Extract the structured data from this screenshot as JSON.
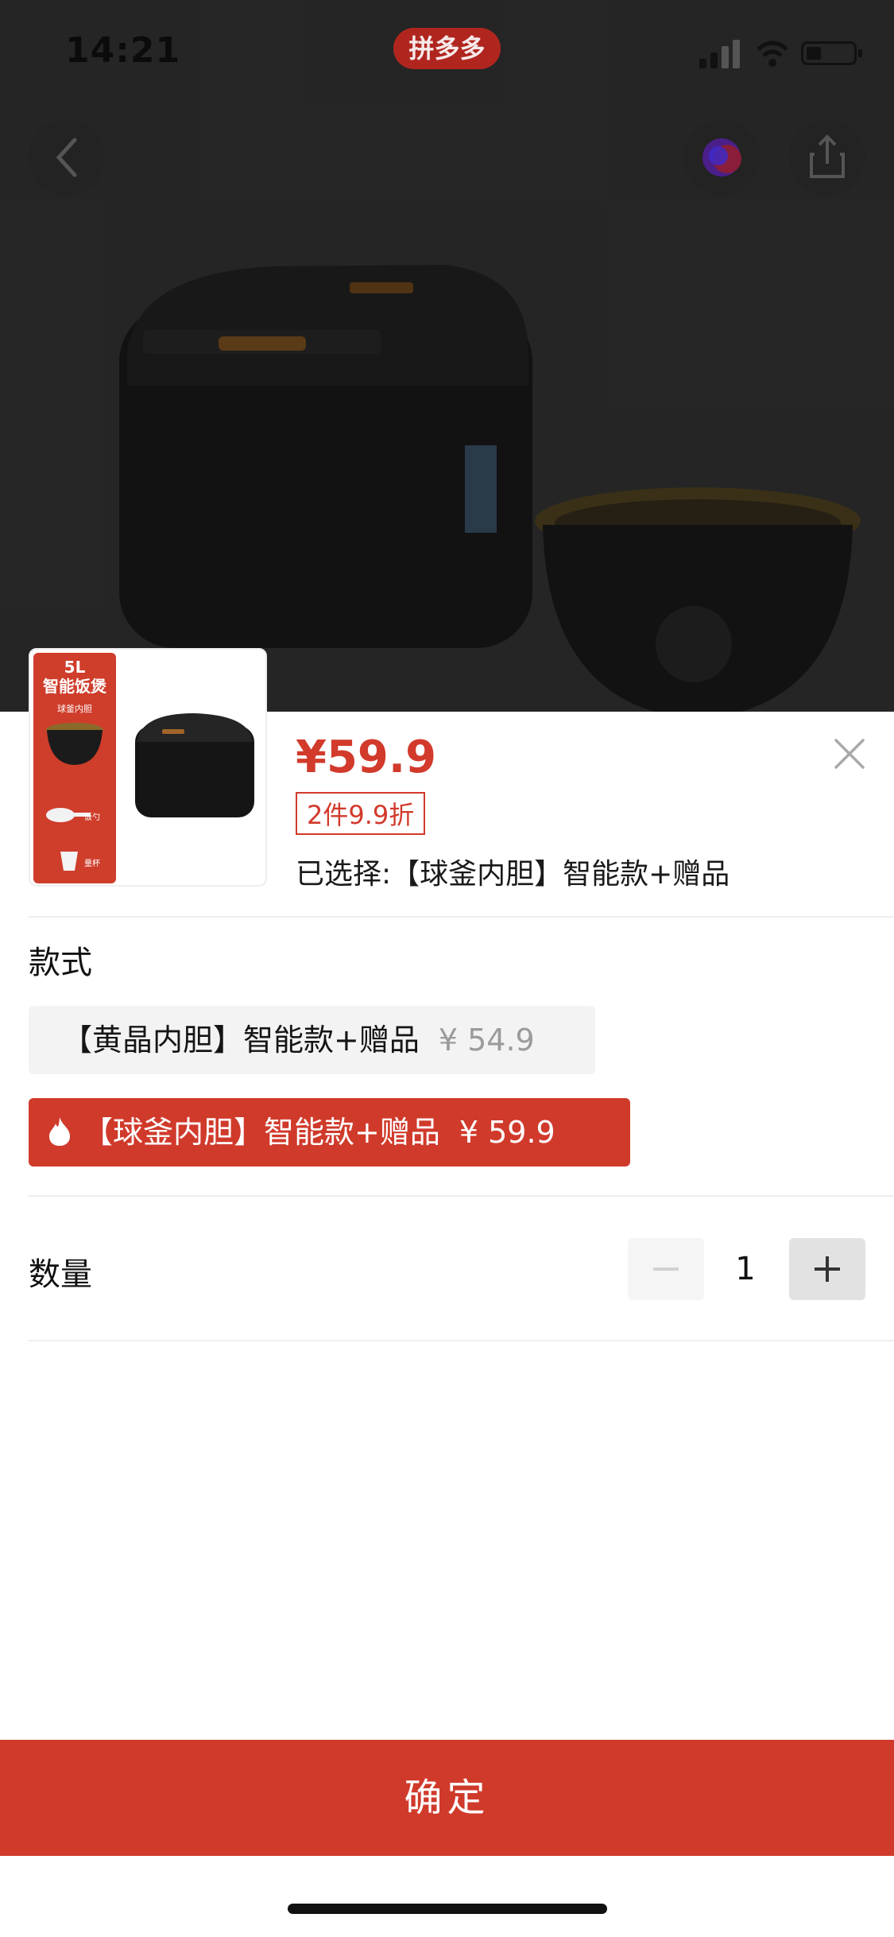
{
  "status_bar": {
    "time": "14:21",
    "app_badge": "拼多多"
  },
  "product": {
    "price": "¥59.9",
    "discount_tag": "2件9.9折",
    "selected_label": "已选择:【球釜内胆】智能款+赠品",
    "thumbnail": {
      "capacity": "5L",
      "title": "智能饭煲",
      "subtitle": "球釜内胆",
      "accessory_1": "饭勺",
      "accessory_2": "量杯"
    }
  },
  "style_section": {
    "title": "款式",
    "options": [
      {
        "label": "【黄晶内胆】智能款+赠品",
        "price": "¥ 54.9",
        "selected": false
      },
      {
        "label": "【球釜内胆】智能款+赠品",
        "price": "¥ 59.9",
        "selected": true
      }
    ]
  },
  "quantity_section": {
    "title": "数量",
    "value": "1",
    "minus_label": "−",
    "plus_label": "+"
  },
  "confirm_label": "确定",
  "colors": {
    "accent": "#d03a2b",
    "price_red": "#d23a2b"
  }
}
